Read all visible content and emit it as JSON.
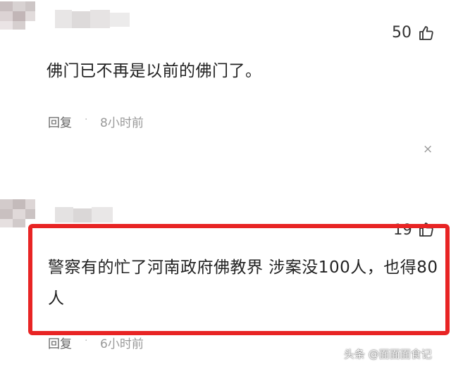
{
  "comments": [
    {
      "likes": "50",
      "text": "佛门已不再是以前的佛门了。",
      "reply_label": "回复",
      "separator": "·",
      "time": "8小时前",
      "close": "×"
    },
    {
      "likes": "19",
      "text_line1": "警察有的忙了河南政府佛教界 涉案没100人，也得80",
      "text_line2": "人",
      "reply_label": "回复",
      "separator": "·",
      "time": "6小时前"
    }
  ],
  "watermark": "头条 @面面面食记",
  "colors": {
    "highlight": "#e82424",
    "text": "#222222",
    "meta": "#666666"
  },
  "icons": [
    "thumbs-up-icon",
    "close-icon"
  ]
}
